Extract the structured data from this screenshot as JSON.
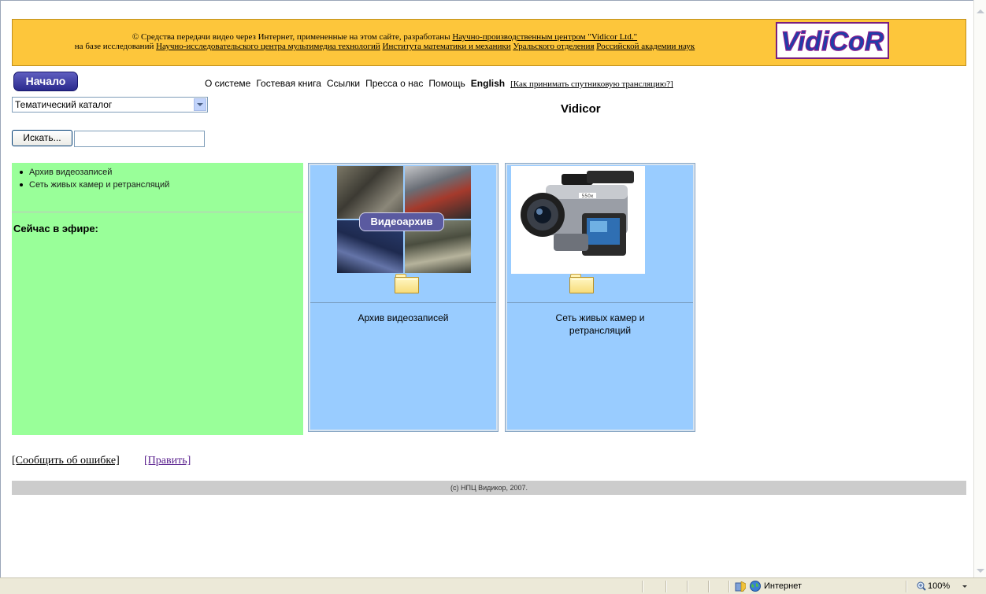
{
  "banner": {
    "line1_prefix": "© Средства передачи видео через Интернет, примененные на этом сайте, разработаны ",
    "line1_link": "Научно-производственным центром \"Vidicor Ltd.\"",
    "line2_prefix": "на базе исследований ",
    "line2_link1": "Научно-исследовательского центра мультимедиа технологий",
    "line2_link2": "Института математики и механики",
    "line2_link3": "Уральского отделения",
    "line2_link4": "Российской академии наук",
    "logo_text": "VidiCoR"
  },
  "nav": {
    "home": "Начало",
    "about": "О системе",
    "guestbook": "Гостевая книга",
    "links": "Ссылки",
    "press": "Пресса о нас",
    "help": "Помощь",
    "english": "English",
    "satellite": "[Как принимать спутниковую трансляцию?]"
  },
  "catalog_select": {
    "value": "Тематический каталог"
  },
  "site_title": "Vidicor",
  "search": {
    "button": "Искать...",
    "value": ""
  },
  "sidebar": {
    "items": [
      "Архив видеозаписей",
      "Сеть живых камер и ретрансляций"
    ],
    "on_air": "Сейчас в эфире:"
  },
  "tiles": [
    {
      "image_caption": "Видеоархив",
      "label_line1": "Архив видеозаписей",
      "label_line2": ""
    },
    {
      "label_line1": "Сеть живых камер и",
      "label_line2": "ретрансляций"
    }
  ],
  "bottom": {
    "report": "[Сообщить об ошибке]",
    "edit": "[Править]"
  },
  "footer": "(c) НПЦ Видикор, 2007.",
  "statusbar": {
    "zone": "Интернет",
    "zoom": "100%"
  },
  "colors": {
    "banner": "#fdc63b",
    "left_panel": "#99ff99",
    "tile": "#99ccff",
    "footer": "#cccccc",
    "home_button": "#3a3aa0"
  }
}
